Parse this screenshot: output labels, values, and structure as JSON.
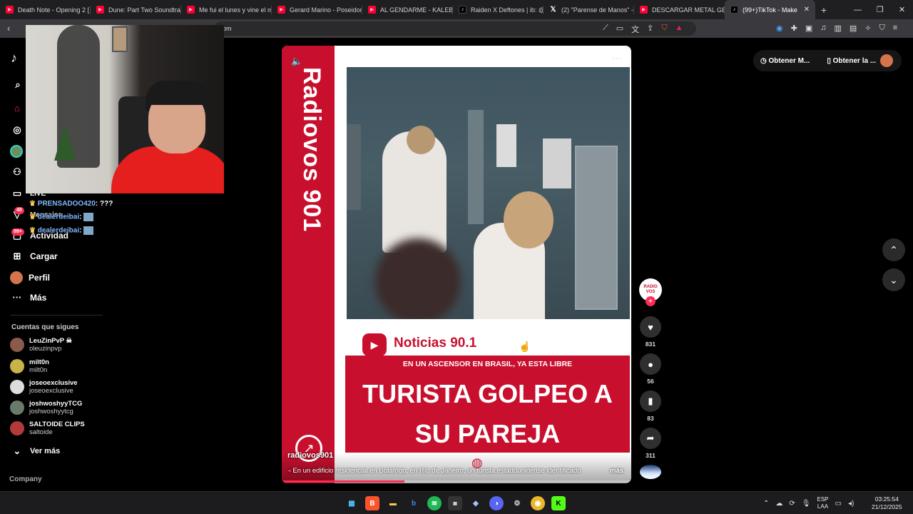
{
  "tabs": [
    {
      "label": "Death Note - Opening 2 [",
      "icon": "youtube-icon"
    },
    {
      "label": "Dune: Part Two Soundtrack",
      "icon": "youtube-icon"
    },
    {
      "label": "Me fui el lunes y vine el m",
      "icon": "youtube-icon"
    },
    {
      "label": "Gerard Marino - Poseidon",
      "icon": "youtube-icon"
    },
    {
      "label": "AL GENDARME - KALEB DI",
      "icon": "youtube-icon"
    },
    {
      "label": "Raiden X Deftones | ib: @",
      "icon": "tiktok-icon"
    },
    {
      "label": "(2) \"Parense de Manos\" -",
      "icon": "x-icon"
    },
    {
      "label": "DESCARGAR METAL GEAR",
      "icon": "youtube-icon"
    },
    {
      "label": "(99+)TikTok - Make",
      "icon": "tiktok-icon"
    }
  ],
  "address": {
    "url_visible": "om"
  },
  "sidebar": {
    "logo": "TikTok",
    "items": [
      {
        "label": "",
        "icon": "home-icon"
      },
      {
        "label": "",
        "icon": "explore-icon"
      },
      {
        "label": "",
        "icon": "following-icon"
      },
      {
        "label": "",
        "icon": "friends-icon"
      },
      {
        "label": "LIVE",
        "icon": "live-icon"
      },
      {
        "label": "Mensajes",
        "icon": "messages-icon",
        "badge": "48"
      },
      {
        "label": "Actividad",
        "icon": "activity-icon",
        "badge": "99+"
      },
      {
        "label": "Cargar",
        "icon": "upload-icon"
      },
      {
        "label": "Perfil",
        "icon": "profile-icon"
      },
      {
        "label": "Más",
        "icon": "more-icon"
      }
    ],
    "following_title": "Cuentas que sigues",
    "following": [
      {
        "name": "LeuZinPvP ☠",
        "handle": "oleuzinpvp"
      },
      {
        "name": "milt0n",
        "handle": "milt0n"
      },
      {
        "name": "joseoexclusive",
        "handle": "joseoexclusive"
      },
      {
        "name": "joshwoshyyTCG",
        "handle": "joshwoshyytcg"
      },
      {
        "name": "SALTOIDE CLIPS",
        "handle": "saltoide"
      }
    ],
    "see_more": "Ver más",
    "company": "Company"
  },
  "chat": [
    {
      "user": "PRENSADOO420",
      "msg": ": ???"
    },
    {
      "user": "dealerdeibai",
      "msg": ":"
    },
    {
      "user": "dealerdeibai",
      "msg": ":"
    }
  ],
  "video": {
    "vertical_title": "Radiovos 901",
    "outlet": "Noticias 90.1",
    "subheadline": "EN UN ASCENSOR EN BRASIL, YA ESTA LIBRE",
    "headline_line1": "TURISTA GOLPEO A",
    "headline_line2": "SU PAREJA",
    "author": "radiovos901",
    "caption": "En un edificio residencial en Botafogo, en Río de Janeiro, un turista estadounidense identificado",
    "more": "más",
    "progress": 0.35
  },
  "actions": {
    "avatar_text": "RADIO VOS",
    "likes": "831",
    "comments": "56",
    "saves": "83",
    "shares": "311"
  },
  "topbar_right": {
    "get_coins": "Obtener M...",
    "get_app": "Obtener la ..."
  },
  "taskbar": {
    "lang1": "ESP",
    "lang2": "LAA",
    "time": "03:25:54",
    "date": "21/12/2025"
  },
  "colors": {
    "accent": "#fe2c55",
    "brand_red": "#c8102e"
  }
}
